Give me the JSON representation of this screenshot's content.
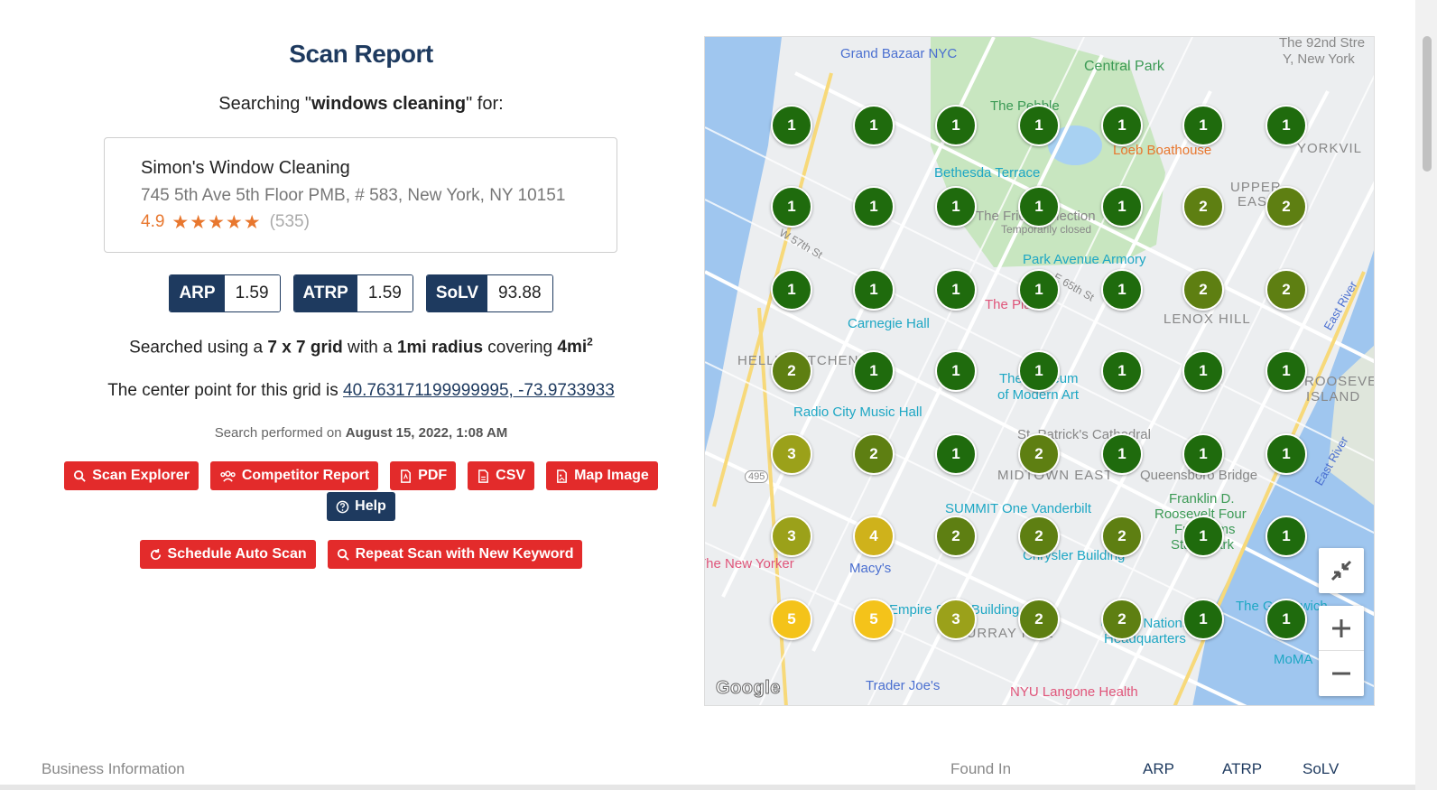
{
  "report": {
    "title": "Scan Report",
    "searching_prefix": "Searching \"",
    "keyword": "windows cleaning",
    "searching_suffix": "\" for:"
  },
  "business": {
    "name": "Simon's Window Cleaning",
    "address": "745 5th Ave 5th Floor PMB, # 583, New York, NY 10151",
    "rating": "4.9",
    "stars": 5,
    "review_count": "(535)"
  },
  "metrics": [
    {
      "label": "ARP",
      "value": "1.59"
    },
    {
      "label": "ATRP",
      "value": "1.59"
    },
    {
      "label": "SoLV",
      "value": "93.88"
    }
  ],
  "grid_info": {
    "t1": "Searched using a ",
    "grid": "7 x 7 grid",
    "t2": " with a ",
    "radius": "1mi radius",
    "t3": " covering ",
    "area": "4mi",
    "sup": "2"
  },
  "center": {
    "prefix": "The center point for this grid is ",
    "coords": "40.763171199999995, -73.9733933"
  },
  "performed": {
    "prefix": "Search performed on ",
    "date": "August 15, 2022, 1:08 AM"
  },
  "buttons": {
    "scan_explorer": "Scan Explorer",
    "competitor_report": "Competitor Report",
    "pdf": "PDF",
    "csv": "CSV",
    "map_image": "Map Image",
    "help": "Help",
    "schedule": "Schedule Auto Scan",
    "repeat": "Repeat Scan with New Keyword"
  },
  "map": {
    "grid_ranks": [
      [
        1,
        1,
        1,
        1,
        1,
        1,
        1
      ],
      [
        1,
        1,
        1,
        1,
        1,
        2,
        2
      ],
      [
        1,
        1,
        1,
        1,
        1,
        2,
        2
      ],
      [
        2,
        1,
        1,
        1,
        1,
        1,
        1
      ],
      [
        3,
        2,
        1,
        2,
        1,
        1,
        1
      ],
      [
        3,
        4,
        2,
        2,
        2,
        1,
        1
      ],
      [
        5,
        5,
        3,
        2,
        2,
        1,
        1
      ]
    ],
    "rank_colors": {
      "1": "#1f6b0d",
      "2": "#5e7f12",
      "3": "#9ba11a",
      "4": "#cfb21b",
      "5": "#f4c31a"
    },
    "labels": {
      "grand_bazaar": "Grand Bazaar NYC",
      "central_park": "Central Park",
      "the_92nd": "The 92nd Stre",
      "y_ny": "Y, New York",
      "the_pebble": "The Pebble",
      "loeb": "Loeb Boathouse",
      "yorkville": "YORKVIL",
      "bethesda": "Bethesda Terrace",
      "upper_east": "UPPER",
      "east": "EAST",
      "frick": "The Frick Collection",
      "temp_closed": "Temporarily closed",
      "park_ave": "Park Avenue Armory",
      "plaza": "The Plaza",
      "lenox": "LENOX HILL",
      "carnegie": "Carnegie Hall",
      "hells": "HELL'S KITCHEN",
      "moma1": "The Museum",
      "moma2": "of Modern Art",
      "roosevelt1": "ROOSEVEL",
      "roosevelt2": "ISLAND",
      "radio": "Radio City Music Hall",
      "st_patricks": "St. Patrick's Cathedral",
      "midtown": "MIDTOWN EAST",
      "queensboro": "Queensboro Bridge",
      "summit": "SUMMIT One Vanderbilt",
      "fdr1": "Franklin D.",
      "fdr2": "Roosevelt Four",
      "fdr3": "Freedoms",
      "fdr4": "State Park",
      "new_yorker": "The New Yorker",
      "macys": "Macy's",
      "chrysler": "Chrysler Building",
      "empire": "Empire State Building",
      "murray": "MURRAY HILL",
      "un1": "United Nations",
      "un2": "Headquarters",
      "trader": "Trader Joe's",
      "nyu": "NYU Langone Health",
      "moma_ps": "MoMA",
      "google": "Google",
      "east_river1": "East River",
      "east_river2": "East River",
      "w57": "W 57th St",
      "e65": "E 65th St",
      "rt495": "495",
      "the_greenwich": "The Greenwich"
    }
  },
  "table_header": {
    "business_info": "Business Information",
    "found_in": "Found In",
    "arp": "ARP",
    "atrp": "ATRP",
    "solv": "SoLV"
  }
}
